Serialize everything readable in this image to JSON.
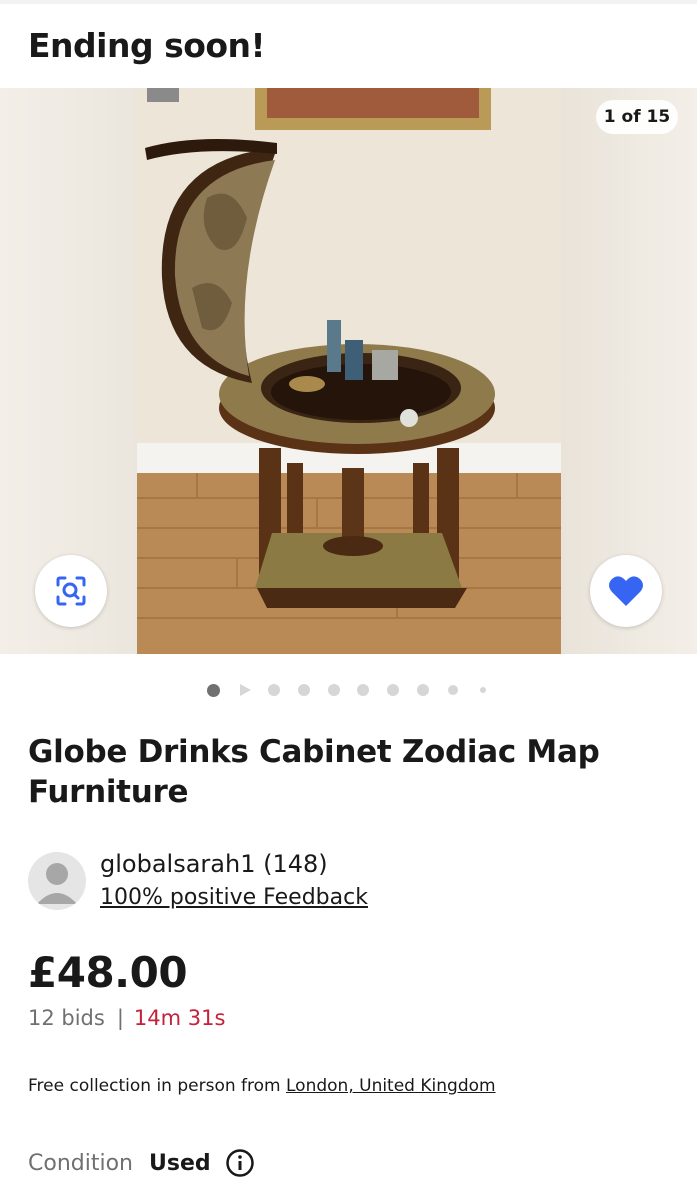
{
  "banner": {
    "title": "Ending soon!"
  },
  "gallery": {
    "counter": "1 of 15",
    "image_alt": "Globe drinks cabinet, open, with bottles inside",
    "dots_total": 10,
    "dots_active": 0
  },
  "item": {
    "title": "Globe Drinks Cabinet Zodiac Map Furniture"
  },
  "seller": {
    "name": "globalsarah1 (148)",
    "feedback": "100% positive Feedback"
  },
  "pricing": {
    "price": "£48.00",
    "bids": "12 bids",
    "separator": "|",
    "time_left": "14m 31s"
  },
  "delivery": {
    "text": "Free collection in person from ",
    "location": "London, United Kingdom"
  },
  "condition": {
    "label": "Condition",
    "value": "Used"
  },
  "icons": {
    "search": "image-search-icon",
    "heart": "heart-icon",
    "avatar": "avatar-icon",
    "info": "info-icon"
  },
  "colors": {
    "accent": "#3665f3",
    "time_left": "#c4213a",
    "muted": "#707070"
  }
}
